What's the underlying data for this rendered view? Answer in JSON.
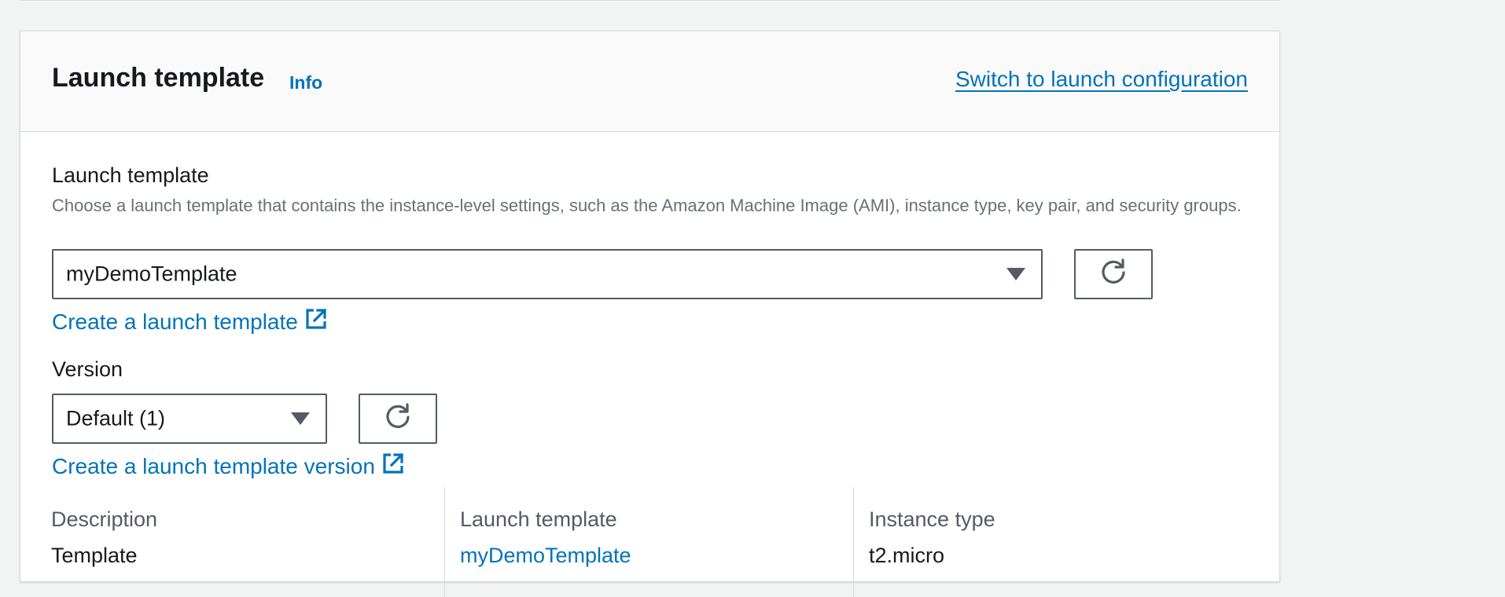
{
  "header": {
    "title": "Launch template",
    "info_label": "Info",
    "switch_link": "Switch to launch configuration"
  },
  "launch_template_field": {
    "label": "Launch template",
    "description": "Choose a launch template that contains the instance-level settings, such as the Amazon Machine Image (AMI), instance type, key pair, and security groups.",
    "selected_value": "myDemoTemplate",
    "create_link": "Create a launch template"
  },
  "version_field": {
    "label": "Version",
    "selected_value": "Default (1)",
    "create_link": "Create a launch template version"
  },
  "summary_columns": [
    {
      "label": "Description",
      "value": "Template"
    },
    {
      "label": "Launch template",
      "value": "myDemoTemplate"
    },
    {
      "label": "Instance type",
      "value": "t2.micro"
    }
  ],
  "colors": {
    "link": "#0073bb",
    "border": "#545b64",
    "header_bg": "#fafafa",
    "page_bg": "#f2f3f3"
  },
  "icons": [
    "caret-down-icon",
    "refresh-icon",
    "external-link-icon"
  ]
}
